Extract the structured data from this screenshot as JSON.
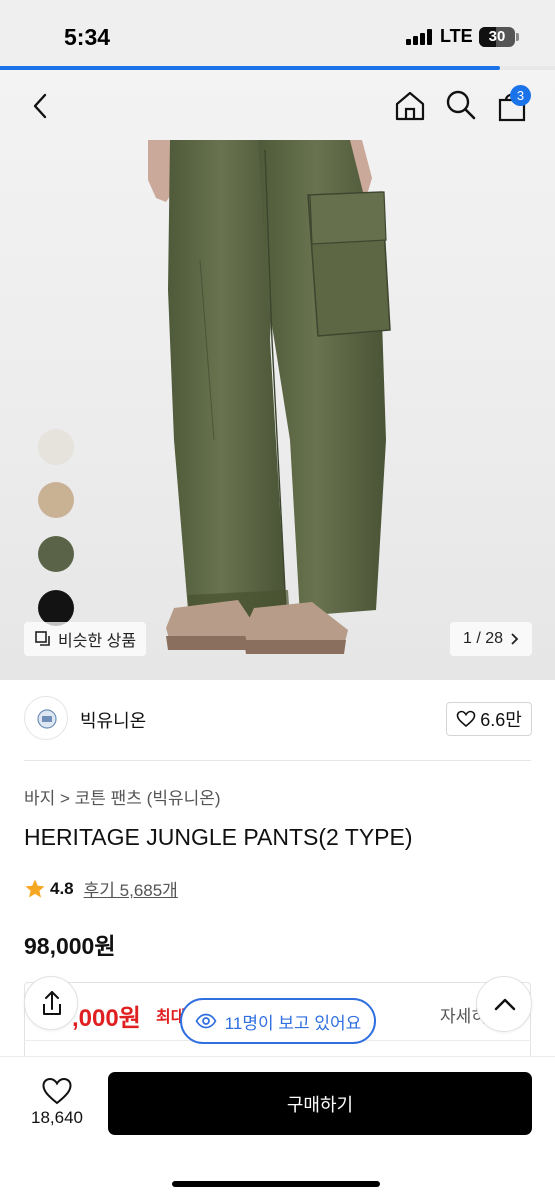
{
  "status_bar": {
    "time": "5:34",
    "network": "LTE",
    "battery": "30"
  },
  "loading": {
    "progress_percent": 90
  },
  "header": {
    "cart_count": "3"
  },
  "gallery": {
    "swatches": [
      {
        "name": "cream",
        "color": "#e6e2dc"
      },
      {
        "name": "beige",
        "color": "#c8b293"
      },
      {
        "name": "olive",
        "color": "#5a6347"
      },
      {
        "name": "black",
        "color": "#131313"
      }
    ],
    "similar_label": "비슷한 상품",
    "pager": "1 / 28"
  },
  "brand": {
    "name": "빅유니온",
    "likes": "6.6만"
  },
  "product": {
    "breadcrumb": "바지 > 코튼 팬츠 (빅유니온)",
    "title": "HERITAGE JUNGLE PANTS(2 TYPE)",
    "rating": "4.8",
    "reviews": "후기 5,685개",
    "price": "98,000원"
  },
  "coupon": {
    "price": ",000원",
    "label": "최대",
    "detail": "자세히"
  },
  "viewers": {
    "text": "11명이 보고 있어요"
  },
  "bottom_bar": {
    "wish_count": "18,640",
    "buy_label": "구매하기"
  },
  "colors": {
    "accent": "#1a73e8",
    "sale": "#e02020",
    "star": "#f5a623"
  }
}
